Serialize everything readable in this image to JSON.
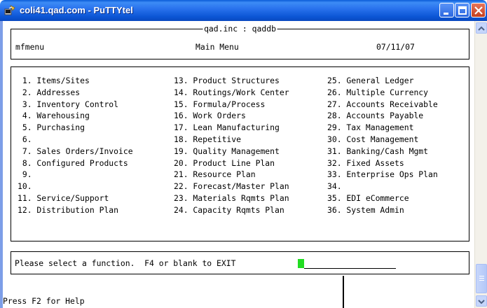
{
  "window": {
    "title": "coli41.qad.com - PuTTYtel"
  },
  "header": {
    "frame_title": "qad.inc : qaddb",
    "program": "mfmenu",
    "menu_title": "Main Menu",
    "date": "07/11/07"
  },
  "menu": {
    "col1": [
      " 1. Items/Sites",
      " 2. Addresses",
      " 3. Inventory Control",
      " 4. Warehousing",
      " 5. Purchasing",
      " 6.",
      " 7. Sales Orders/Invoice",
      " 8. Configured Products",
      " 9.",
      "10.",
      "11. Service/Support",
      "12. Distribution Plan"
    ],
    "col2": [
      "13. Product Structures",
      "14. Routings/Work Center",
      "15. Formula/Process",
      "16. Work Orders",
      "17. Lean Manufacturing",
      "18. Repetitive",
      "19. Quality Management",
      "20. Product Line Plan",
      "21. Resource Plan",
      "22. Forecast/Master Plan",
      "23. Materials Rqmts Plan",
      "24. Capacity Rqmts Plan"
    ],
    "col3": [
      "25. General Ledger",
      "26. Multiple Currency",
      "27. Accounts Receivable",
      "28. Accounts Payable",
      "29. Tax Management",
      "30. Cost Management",
      "31. Banking/Cash Mgmt",
      "32. Fixed Assets",
      "33. Enterprise Ops Plan",
      "34.",
      "35. EDI eCommerce",
      "36. System Admin"
    ]
  },
  "prompt": {
    "text": "Please select a function.  F4 or blank to EXIT",
    "input_value": ""
  },
  "status_line": "Press F2 for Help",
  "colors": {
    "titlebar": "#2a73ee",
    "cursor": "#22dd22",
    "close_button": "#c3401f"
  }
}
